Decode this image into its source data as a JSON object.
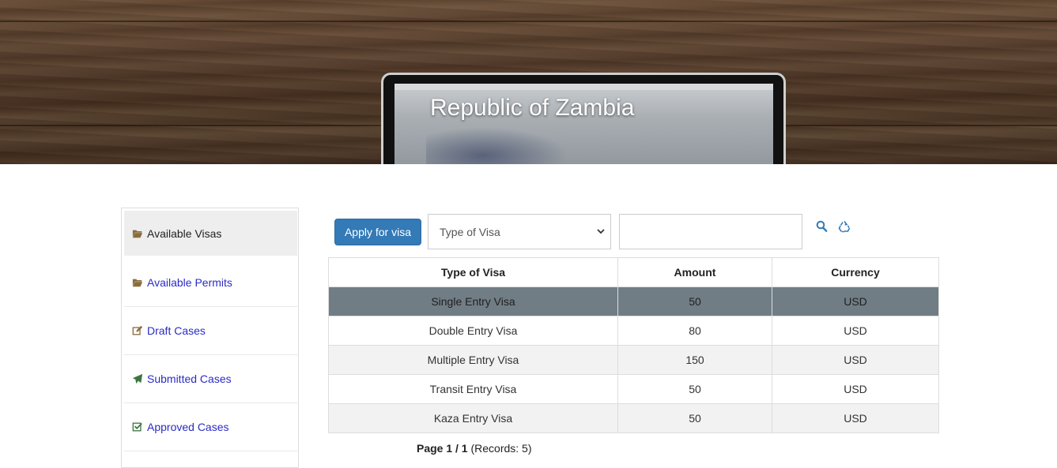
{
  "header": {
    "title": "Republic of Zambia"
  },
  "sidebar": {
    "items": [
      {
        "label": "Available Visas",
        "icon": "folder-open-icon",
        "active": true
      },
      {
        "label": "Available Permits",
        "icon": "folder-open-icon",
        "active": false
      },
      {
        "label": "Draft Cases",
        "icon": "edit-icon",
        "active": false
      },
      {
        "label": "Submitted Cases",
        "icon": "send-icon",
        "active": false
      },
      {
        "label": "Approved Cases",
        "icon": "check-square-icon",
        "active": false
      }
    ]
  },
  "toolbar": {
    "apply_label": "Apply for visa",
    "filter_selected": "Type of Visa",
    "search_value": "",
    "search_icon": "search-icon",
    "reset_icon": "recycle-icon"
  },
  "table": {
    "columns": [
      "Type of Visa",
      "Amount",
      "Currency"
    ],
    "rows": [
      [
        "Single Entry Visa",
        "50",
        "USD"
      ],
      [
        "Double Entry Visa",
        "80",
        "USD"
      ],
      [
        "Multiple Entry Visa",
        "150",
        "USD"
      ],
      [
        "Transit Entry Visa",
        "50",
        "USD"
      ],
      [
        "Kaza Entry Visa",
        "50",
        "USD"
      ]
    ],
    "selected_row": 0
  },
  "pager": {
    "page_label": "Page 1 / 1",
    "records_label": "(Records: 5)"
  },
  "colors": {
    "primary": "#337ab7",
    "link": "#2b2bc7",
    "selected_row": "#717d85",
    "folder_icon": "#8a6d3b",
    "send_icon": "#3c763d",
    "accent_icon": "#337ab7"
  }
}
